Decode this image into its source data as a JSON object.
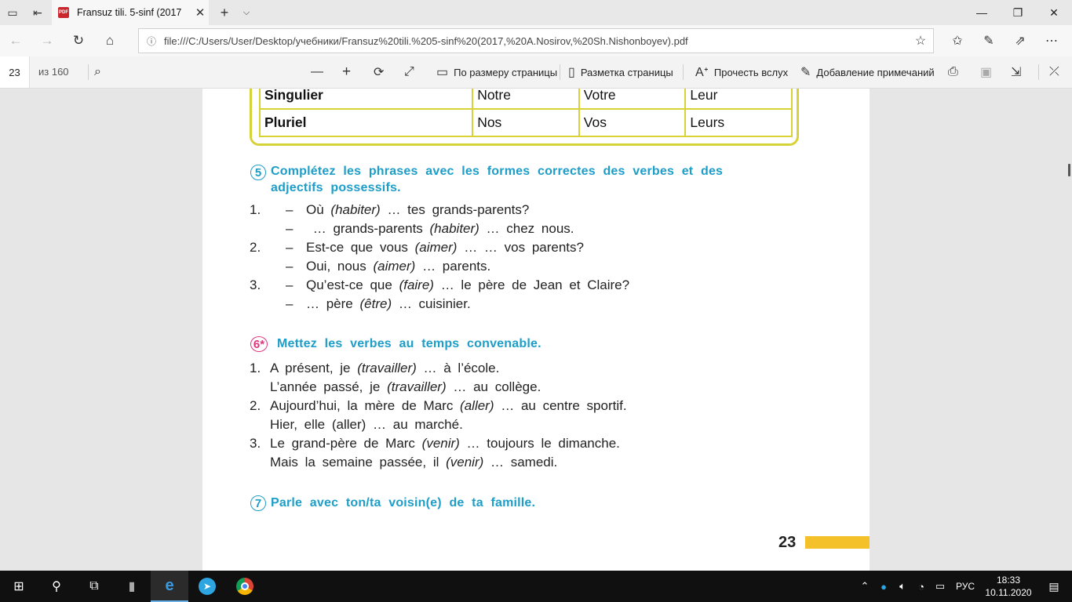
{
  "browser": {
    "tab_title": "Fransuz tili. 5-sinf (2017",
    "url": "file:///C:/Users/User/Desktop/учебники/Fransuz%20tili.%205-sinf%20(2017,%20A.Nosirov,%20Sh.Nishonboyev).pdf",
    "pdf_icon_text": "PDF"
  },
  "pdf_toolbar": {
    "page_current": "23",
    "page_total": "из 160",
    "fit_page": "По размеру страницы",
    "page_layout": "Разметка страницы",
    "read_aloud": "Прочесть вслух",
    "add_notes": "Добавление примечаний"
  },
  "document": {
    "table": {
      "rows": [
        {
          "label": "Singulier",
          "cells": [
            "Notre",
            "Votre",
            "Leur"
          ]
        },
        {
          "label": "Pluriel",
          "cells": [
            "Nos",
            "Vos",
            "Leurs"
          ]
        }
      ]
    },
    "ex5": {
      "number": "5",
      "title_line1": "Complétez les phrases avec les formes correctes des verbes et des",
      "title_line2": "adjectifs possessifs.",
      "items": [
        {
          "num": "1.",
          "dash": "–",
          "pre": "Où ",
          "verb": "(habiter)",
          "post": " … tes grands-parents?"
        },
        {
          "num": "",
          "dash": "–",
          "pre": " … grands-parents ",
          "verb": "(habiter)",
          "post": " … chez nous."
        },
        {
          "num": "2.",
          "dash": "–",
          "pre": "Est-ce que vous ",
          "verb": "(aimer)",
          "post": " … … vos parents?"
        },
        {
          "num": "",
          "dash": "–",
          "pre": "Oui, nous ",
          "verb": "(aimer)",
          "post": " … parents."
        },
        {
          "num": "3.",
          "dash": "–",
          "pre": "Qu’est-ce que ",
          "verb": "(faire)",
          "post": " … le père de Jean et Claire?"
        },
        {
          "num": "",
          "dash": "–",
          "pre": "… père ",
          "verb": "(être)",
          "post": " … cuisinier."
        }
      ]
    },
    "ex6": {
      "number": "6*",
      "title": "Mettez les verbes au temps convenable.",
      "items": [
        {
          "num": "1.",
          "pre": "A présent, je ",
          "verb": "(travailler)",
          "post": " … à l’école."
        },
        {
          "num": "",
          "pre": "L’année passé, je ",
          "verb": "(travailler)",
          "post": " … au collège."
        },
        {
          "num": "2.",
          "pre": "Aujourd’hui, la mère de Marc ",
          "verb": "(aller)",
          "post": " … au centre sportif."
        },
        {
          "num": "",
          "pre": "Hier, elle (aller) … au marché.",
          "verb": "",
          "post": ""
        },
        {
          "num": "3.",
          "pre": "Le grand-père de Marc ",
          "verb": "(venir)",
          "post": " … toujours le dimanche."
        },
        {
          "num": "",
          "pre": "Mais la semaine passée, il ",
          "verb": "(venir)",
          "post": " … samedi."
        }
      ]
    },
    "ex7": {
      "number": "7",
      "title": "Parle avec ton/ta voisin(e) de ta famille."
    },
    "page_number": "23"
  },
  "taskbar": {
    "language": "РУС",
    "time": "18:33",
    "date": "10.11.2020"
  },
  "colors": {
    "heading_blue": "#1d9ec8",
    "table_border": "#d7d236",
    "exercise6_pink": "#e0347d",
    "page_bar_yellow": "#f4c12b"
  }
}
